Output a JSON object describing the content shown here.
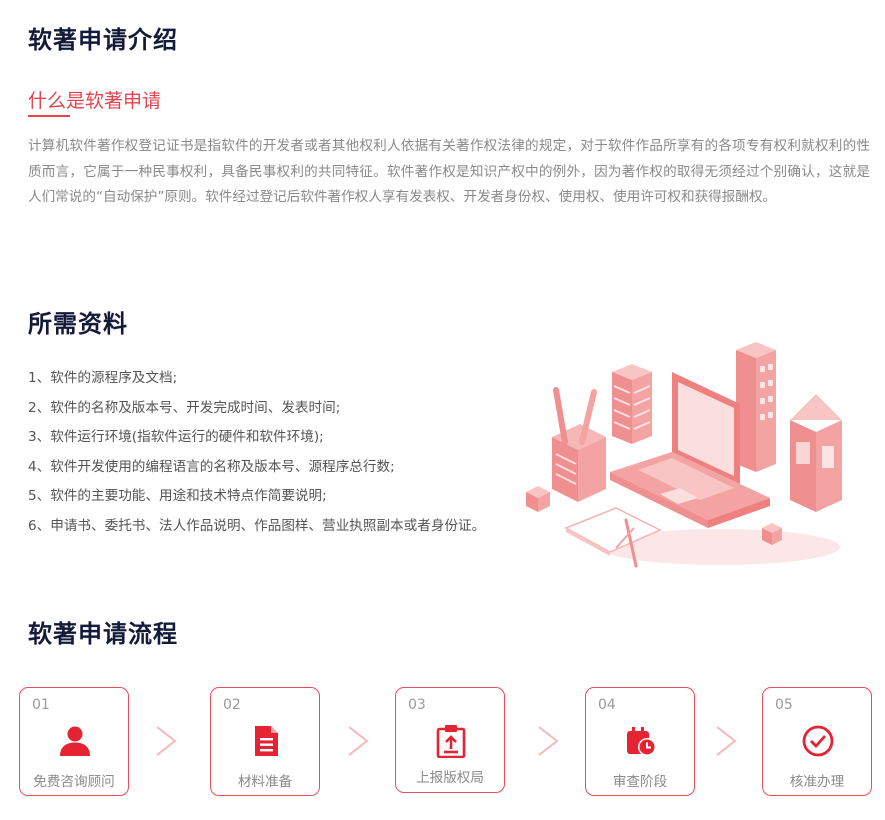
{
  "intro": {
    "heading": "软著申请介绍",
    "subheading": "什么是软著申请",
    "paragraph": "计算机软件著作权登记证书是指软件的开发者或者其他权利人依据有关著作权法律的规定，对于软件作品所享有的各项专有权利就权利的性质而言，它属于一种民事权利，具备民事权利的共同特征。软件著作权是知识产权中的例外，因为著作权的取得无须经过个别确认，这就是人们常说的“自动保护”原则。软件经过登记后软件著作权人享有发表权、开发者身份权、使用权、使用许可权和获得报酬权。"
  },
  "materials": {
    "heading": "所需资料",
    "items": [
      "1、软件的源程序及文档;",
      "2、软件的名称及版本号、开发完成时间、发表时间;",
      "3、软件运行环境(指软件运行的硬件和软件环境);",
      "4、软件开发使用的编程语言的名称及版本号、源程序总行数;",
      "5、软件的主要功能、用途和技术特点作简要说明;",
      "6、申请书、委托书、法人作品说明、作品图样、营业执照副本或者身份证。"
    ]
  },
  "process": {
    "heading": "软著申请流程",
    "steps": [
      {
        "num": "01",
        "label": "免费咨询顾问",
        "icon": "user-icon"
      },
      {
        "num": "02",
        "label": "材料准备",
        "icon": "document-icon"
      },
      {
        "num": "03",
        "label": "上报版权局",
        "icon": "clipboard-upload-icon"
      },
      {
        "num": "04",
        "label": "审查阶段",
        "icon": "calendar-clock-icon"
      },
      {
        "num": "05",
        "label": "核准办理",
        "icon": "check-circle-icon"
      }
    ]
  },
  "colors": {
    "accent": "#e6434f",
    "heading": "#141a3a",
    "body_text": "#8a8a8a",
    "step_border": "#e84f5b",
    "illustration": "#f08f8f"
  }
}
